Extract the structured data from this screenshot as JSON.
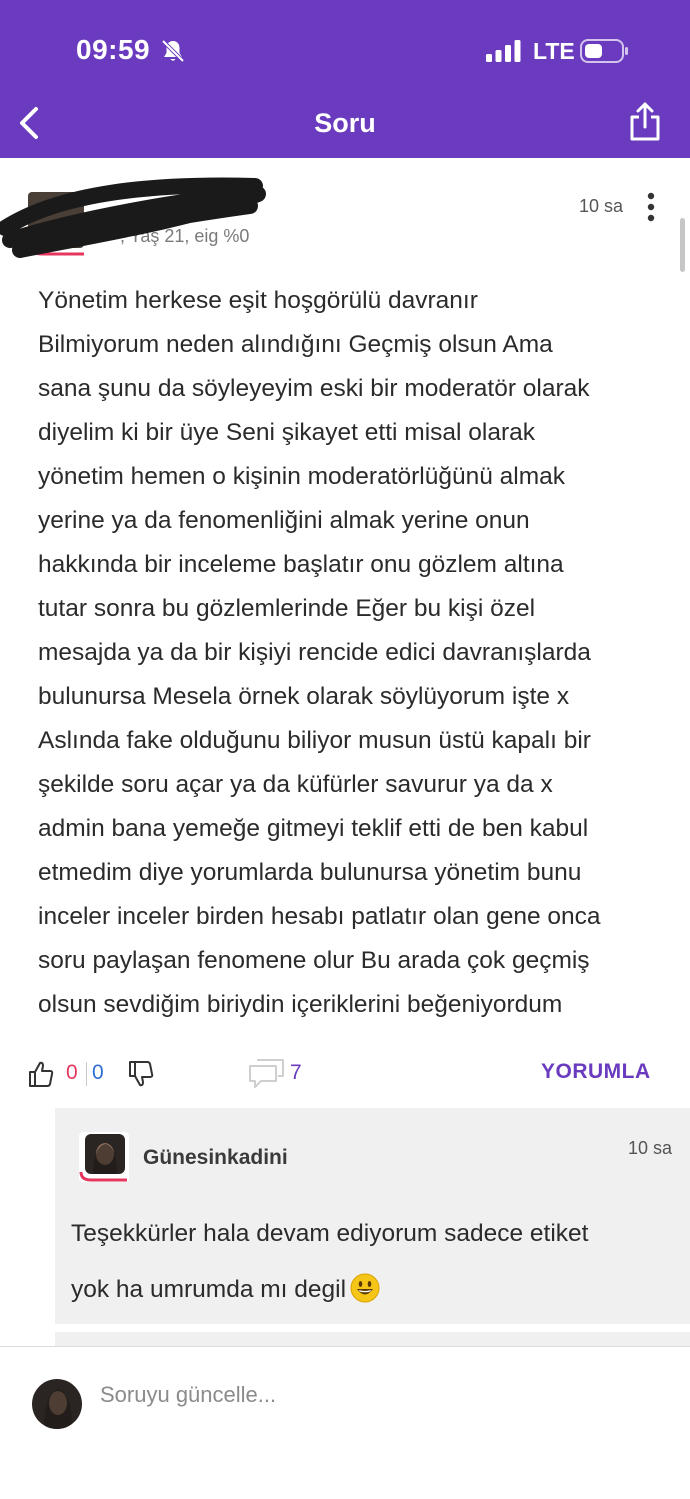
{
  "status_bar": {
    "time": "09:59",
    "network": "LTE",
    "icons": [
      "bell-muted-icon",
      "signal-icon",
      "battery-icon"
    ]
  },
  "nav": {
    "title": "Soru",
    "back_icon": "chevron-left-icon",
    "share_icon": "share-icon"
  },
  "answer": {
    "author_meta": ", Yaş 21, eig %0",
    "time": "10 sa",
    "lines": [
      "Yönetim herkese eşit hoşgörülü davranır",
      "Bilmiyorum neden alındığını Geçmiş olsun Ama",
      "sana şunu da söyleyeyim eski bir moderatör olarak",
      "diyelim ki bir üye Seni şikayet etti misal olarak",
      "yönetim hemen o kişinin moderatörlüğünü almak",
      "yerine ya da fenomenliğini almak yerine onun",
      "hakkında bir inceleme başlatır onu gözlem altına",
      "tutar sonra bu gözlemlerinde Eğer bu kişi özel",
      "mesajda ya da bir kişiyi rencide edici davranışlarda",
      "bulunursa Mesela örnek olarak söylüyorum işte x",
      "Aslında fake olduğunu biliyor musun üstü kapalı bir",
      "şekilde soru açar ya da küfürler savurur ya da x",
      "admin bana yemeğe gitmeyi teklif etti de ben kabul",
      "etmedim diye yorumlarda bulunursa yönetim bunu",
      "inceler inceler birden hesabı patlatır olan gene onca",
      "soru paylaşan fenomene olur Bu arada çok geçmiş",
      "olsun sevdiğim biriydin içeriklerini beğeniyordum"
    ],
    "likes": "0",
    "dislikes": "0",
    "comments": "7",
    "reply_label": "YORUMLA"
  },
  "reply": {
    "username": "Günesinkadini",
    "time": "10 sa",
    "lines": [
      "Teşekkürler hala devam ediyorum sadece etiket",
      "yok ha umrumda mı degil"
    ],
    "emoji": "😃"
  },
  "input": {
    "placeholder": "Soruyu güncelle..."
  },
  "colors": {
    "header": "#6a3bbf",
    "accent": "#6a3bbf",
    "like": "#e5365d",
    "dislike": "#2e6fd1",
    "card_bg": "#f0f0f0"
  }
}
